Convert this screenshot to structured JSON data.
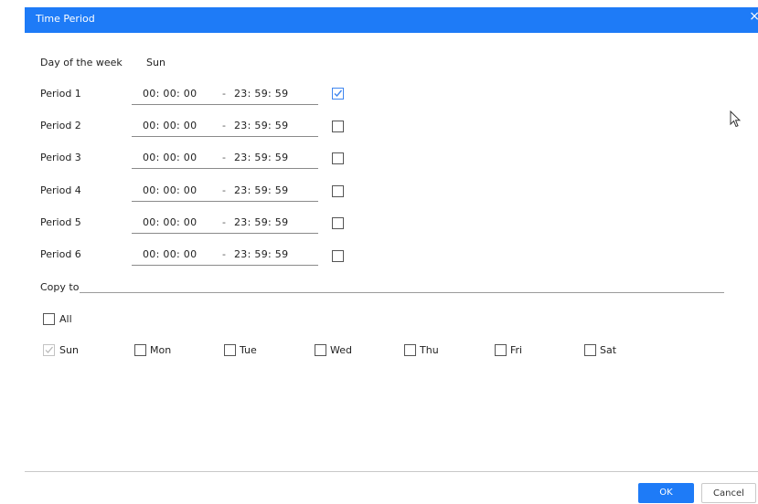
{
  "dialog": {
    "title": "Time Period"
  },
  "day_of_week": {
    "label": "Day of the week",
    "value": "Sun"
  },
  "periods": [
    {
      "label": "Period 1",
      "start": "00: 00: 00",
      "end": "23: 59: 59",
      "checked": true
    },
    {
      "label": "Period 2",
      "start": "00: 00: 00",
      "end": "23: 59: 59",
      "checked": false
    },
    {
      "label": "Period 3",
      "start": "00: 00: 00",
      "end": "23: 59: 59",
      "checked": false
    },
    {
      "label": "Period 4",
      "start": "00: 00: 00",
      "end": "23: 59: 59",
      "checked": false
    },
    {
      "label": "Period 5",
      "start": "00: 00: 00",
      "end": "23: 59: 59",
      "checked": false
    },
    {
      "label": "Period 6",
      "start": "00: 00: 00",
      "end": "23: 59: 59",
      "checked": false
    }
  ],
  "separator": "-",
  "copy_to": {
    "label": "Copy to",
    "all_label": "All",
    "days": [
      {
        "label": "Sun",
        "checked": true,
        "disabled": true
      },
      {
        "label": "Mon",
        "checked": false
      },
      {
        "label": "Tue",
        "checked": false
      },
      {
        "label": "Wed",
        "checked": false
      },
      {
        "label": "Thu",
        "checked": false
      },
      {
        "label": "Fri",
        "checked": false
      },
      {
        "label": "Sat",
        "checked": false
      }
    ]
  },
  "buttons": {
    "ok": "OK",
    "cancel": "Cancel"
  },
  "colors": {
    "accent": "#1e7bf7"
  }
}
